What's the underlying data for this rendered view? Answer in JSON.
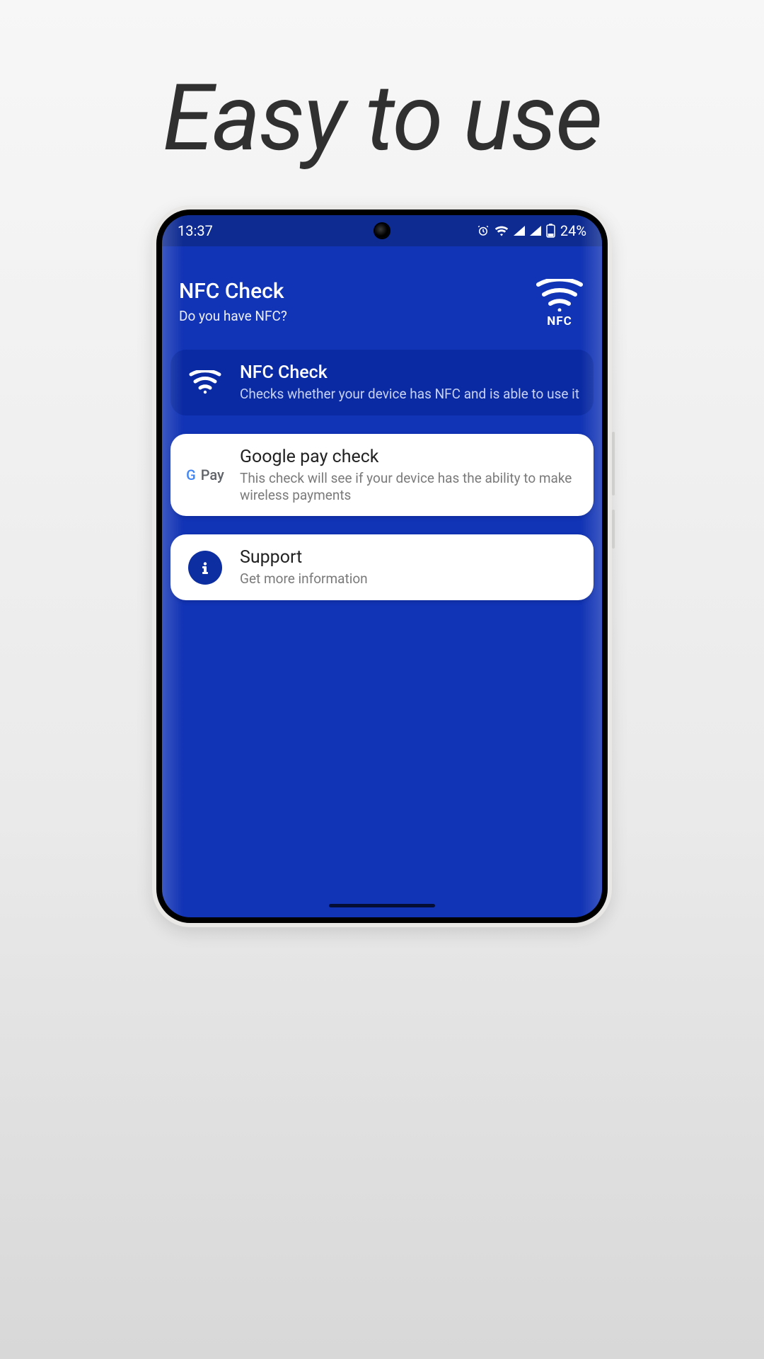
{
  "headline": "Easy to use",
  "statusbar": {
    "time": "13:37",
    "battery_text": "24%",
    "icons": {
      "alarm": "alarm-icon",
      "wifi": "wifi-icon",
      "signal1": "signal-icon",
      "signal2": "signal-icon",
      "battery": "battery-icon"
    }
  },
  "header": {
    "title": "NFC Check",
    "subtitle": "Do you have NFC?",
    "logo_label": "NFC"
  },
  "cards": [
    {
      "id": "nfc-check",
      "title": "NFC Check",
      "subtitle": "Checks whether your device has NFC and is able to use it",
      "icon": "wifi-icon",
      "style": "selected"
    },
    {
      "id": "gpay-check",
      "title": "Google pay check",
      "subtitle": "This check will see if your device has the ability to make wireless payments",
      "icon": "gpay-icon",
      "style": "white"
    },
    {
      "id": "support",
      "title": "Support",
      "subtitle": "Get more information",
      "icon": "info-icon",
      "style": "white"
    }
  ],
  "colors": {
    "app_bg": "#1133b5",
    "statusbar_bg": "#0e2b92",
    "card_selected_bg": "#0a2aa3",
    "accent": "#0d2ea0"
  }
}
